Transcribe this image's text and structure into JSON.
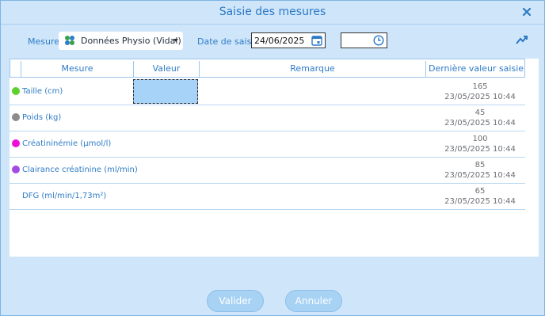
{
  "window": {
    "title": "Saisie des mesures",
    "close_icon": "close-icon"
  },
  "toolbar": {
    "mesure_label": "Mesure",
    "source_select": {
      "value": "Données Physio (Vidal)",
      "icon": "puzzle-icon"
    },
    "date_label": "Date de saisie",
    "date_value": "24/06/2025",
    "time_value": ""
  },
  "table": {
    "headers": {
      "mesure": "Mesure",
      "valeur": "Valeur",
      "remarque": "Remarque",
      "derniere": "Dernière valeur saisie"
    },
    "rows": [
      {
        "label": "Taille (cm)",
        "color": "#5bd12b",
        "last_value": "165",
        "last_date": "23/05/2025 10:44"
      },
      {
        "label": "Poids (kg)",
        "color": "#8c8c8c",
        "last_value": "45",
        "last_date": "23/05/2025 10:44"
      },
      {
        "label": "Créatininémie (µmol/l)",
        "color": "#ee10d8",
        "last_value": "100",
        "last_date": "23/05/2025 10:44"
      },
      {
        "label": "Clairance créatinine (ml/min)",
        "color": "#a44be6",
        "last_value": "85",
        "last_date": "23/05/2025 10:44"
      },
      {
        "label": "DFG (ml/min/1,73m²)",
        "color": "",
        "last_value": "65",
        "last_date": "23/05/2025 10:44"
      }
    ]
  },
  "buttons": {
    "validate": "Valider",
    "cancel": "Annuler"
  }
}
